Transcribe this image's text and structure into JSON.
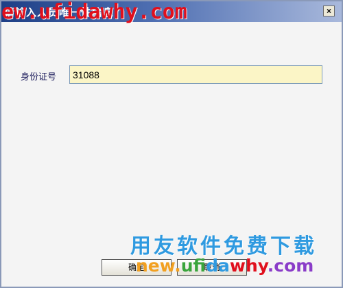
{
  "dialog": {
    "title": "请输入人员唯一性信息",
    "close_label": "×"
  },
  "field": {
    "label": "身份证号",
    "value": "31088"
  },
  "buttons": {
    "ok": "确定",
    "cancel": "取消"
  },
  "watermarks": {
    "top_url": "ew.ufidawhy.com",
    "brand": "用友软件免费下载",
    "url_parts": [
      "new.",
      "ufi",
      "da",
      "why",
      ".com"
    ]
  },
  "colors": {
    "title_bar": "#1e3f86",
    "input_bg": "#fbf5c6",
    "watermark_red": "#e0101d",
    "watermark_blue": "#2f9ae0"
  }
}
